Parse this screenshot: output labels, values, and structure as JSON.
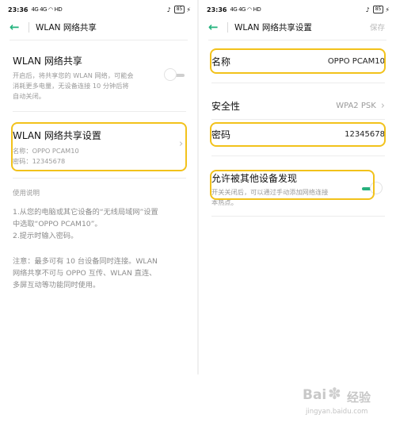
{
  "status": {
    "time": "23:36",
    "signal": "4G 4G",
    "network": "HD",
    "battery": "85"
  },
  "left": {
    "title": "WLAN 网络共享",
    "hotspot": {
      "label": "WLAN 网络共享",
      "desc": [
        "开启后，将共享您的 WLAN 网络，可能会",
        "消耗更多电量，无设备连接 10 分钟后将",
        "自动关闭。"
      ],
      "toggle_on": false
    },
    "settings": {
      "label": "WLAN 网络共享设置",
      "name_line": "名称：OPPO PCAM10",
      "password_line": "密码：12345678"
    },
    "help": {
      "heading": "使用说明",
      "steps": [
        "1.从您的电脑或其它设备的“无线局域网”设置",
        "中选取“OPPO PCAM10”。",
        "2.提示时输入密码。"
      ],
      "note": [
        "注意：最多可有 10 台设备同时连接。WLAN",
        "网络共享不可与 OPPO 互传、WLAN 直连、",
        "多屏互动等功能同时使用。"
      ]
    }
  },
  "right": {
    "title": "WLAN 网络共享设置",
    "save": "保存",
    "name": {
      "label": "名称",
      "value": "OPPO PCAM10"
    },
    "security": {
      "label": "安全性",
      "value": "WPA2 PSK"
    },
    "password": {
      "label": "密码",
      "value": "12345678"
    },
    "discover": {
      "label": "允许被其他设备发现",
      "desc": [
        "开关关闭后，可以通过手动添加网络连接",
        "本热点。"
      ],
      "toggle_on": true
    }
  },
  "watermark": {
    "brand": "Bai",
    "brand2": "经验",
    "url": "jingyan.baidu.com"
  },
  "colors": {
    "accent": "#27b07d",
    "highlight": "#f2c21b"
  }
}
